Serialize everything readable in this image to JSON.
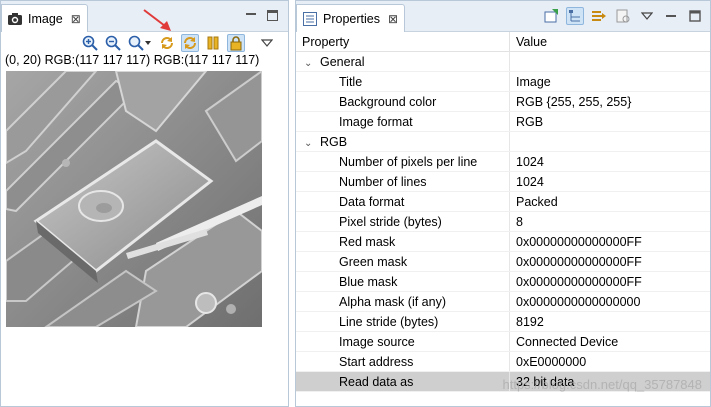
{
  "image_view": {
    "tab_title": "Image",
    "tab_close": "⊠",
    "status": "(0, 20) RGB:(117 117 117) RGB:(117 117 117)",
    "toolbar_icons": [
      "zoom-in-icon",
      "zoom-out-icon",
      "zoom-fit-icon",
      "refresh-icon",
      "auto-refresh-icon",
      "pause-icon",
      "lock-icon",
      "view-menu-icon"
    ]
  },
  "props_view": {
    "tab_title": "Properties",
    "tab_close": "⊠",
    "header": {
      "property": "Property",
      "value": "Value"
    },
    "sections": [
      {
        "name": "General",
        "rows": [
          {
            "property": "Title",
            "value": "Image"
          },
          {
            "property": "Background color",
            "value": "RGB {255, 255, 255}"
          },
          {
            "property": "Image format",
            "value": "RGB"
          }
        ]
      },
      {
        "name": "RGB",
        "rows": [
          {
            "property": "Number of pixels per line",
            "value": "1024"
          },
          {
            "property": "Number of lines",
            "value": "1024"
          },
          {
            "property": "Data format",
            "value": "Packed"
          },
          {
            "property": "Pixel stride (bytes)",
            "value": "8"
          },
          {
            "property": "Red mask",
            "value": "0x00000000000000FF"
          },
          {
            "property": "Green mask",
            "value": "0x00000000000000FF"
          },
          {
            "property": "Blue mask",
            "value": "0x00000000000000FF"
          },
          {
            "property": "Alpha mask (if any)",
            "value": "0x0000000000000000"
          },
          {
            "property": "Line stride (bytes)",
            "value": "8192"
          },
          {
            "property": "Image source",
            "value": "Connected Device"
          },
          {
            "property": "Start address",
            "value": "0xE0000000"
          },
          {
            "property": "Read data as",
            "value": "32 bit data"
          }
        ]
      }
    ],
    "watermark": "https://blog.csdn.net/qq_35787848"
  },
  "colors": {
    "accent": "#e03a3a",
    "chrome": "#e8eef6",
    "selected_row": "#cfcfcf"
  }
}
